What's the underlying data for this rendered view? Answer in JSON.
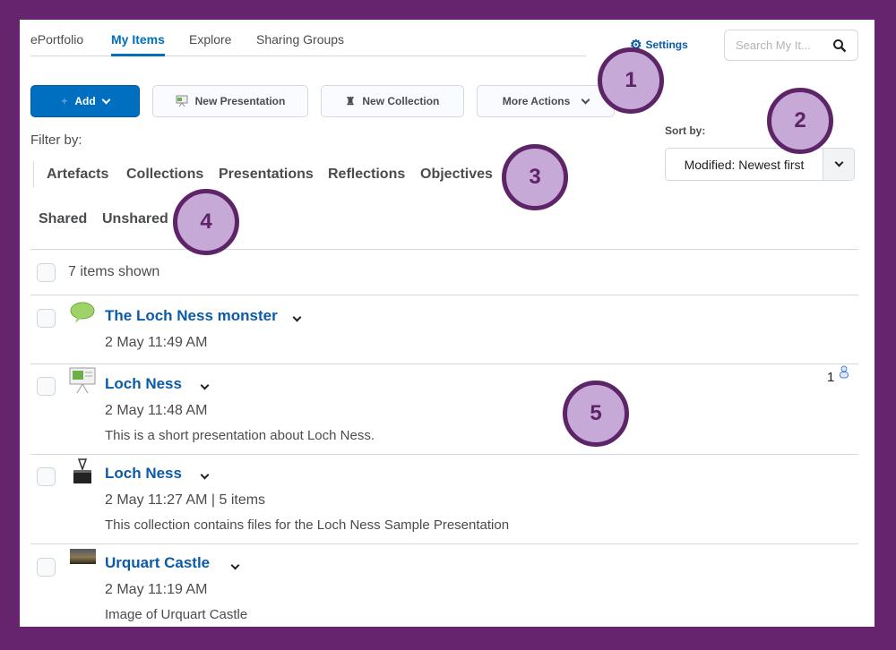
{
  "nav": {
    "tabs": [
      {
        "label": "ePortfolio"
      },
      {
        "label": "My Items",
        "active": true
      },
      {
        "label": "Explore"
      },
      {
        "label": "Sharing Groups"
      }
    ],
    "settings_label": "Settings",
    "search_placeholder": "Search My It..."
  },
  "toolbar": {
    "add_label": "Add",
    "new_presentation_label": "New Presentation",
    "new_collection_label": "New Collection",
    "more_actions_label": "More Actions"
  },
  "filter": {
    "label": "Filter by:",
    "types": [
      "Artefacts",
      "Collections",
      "Presentations",
      "Reflections",
      "Objectives"
    ],
    "sharing": [
      "Shared",
      "Unshared"
    ]
  },
  "sort": {
    "label": "Sort by:",
    "selected": "Modified: Newest first"
  },
  "list": {
    "count_label": "7 items shown",
    "items": [
      {
        "icon": "reflection-icon",
        "title": "The Loch Ness monster",
        "meta": "2 May 11:49 AM",
        "description": ""
      },
      {
        "icon": "presentation-icon",
        "title": "Loch Ness",
        "meta": "2 May 11:48 AM",
        "description": "This is a short presentation about Loch Ness.",
        "shared_count": "1"
      },
      {
        "icon": "collection-icon",
        "title": "Loch Ness",
        "meta": "2 May 11:27 AM | 5 items",
        "description": "This collection contains files for the Loch Ness Sample Presentation"
      },
      {
        "icon": "image-thumbnail-icon",
        "title": "Urquart Castle",
        "meta": "2 May 11:19 AM",
        "description": "Image of Urquart Castle"
      }
    ]
  },
  "callouts": [
    "1",
    "2",
    "3",
    "4",
    "5"
  ],
  "colors": {
    "frame": "#66246f",
    "accent": "#006fbf",
    "link": "#0b5ba8",
    "callout_fill": "#c7a9d8",
    "callout_border": "#5d2468"
  }
}
